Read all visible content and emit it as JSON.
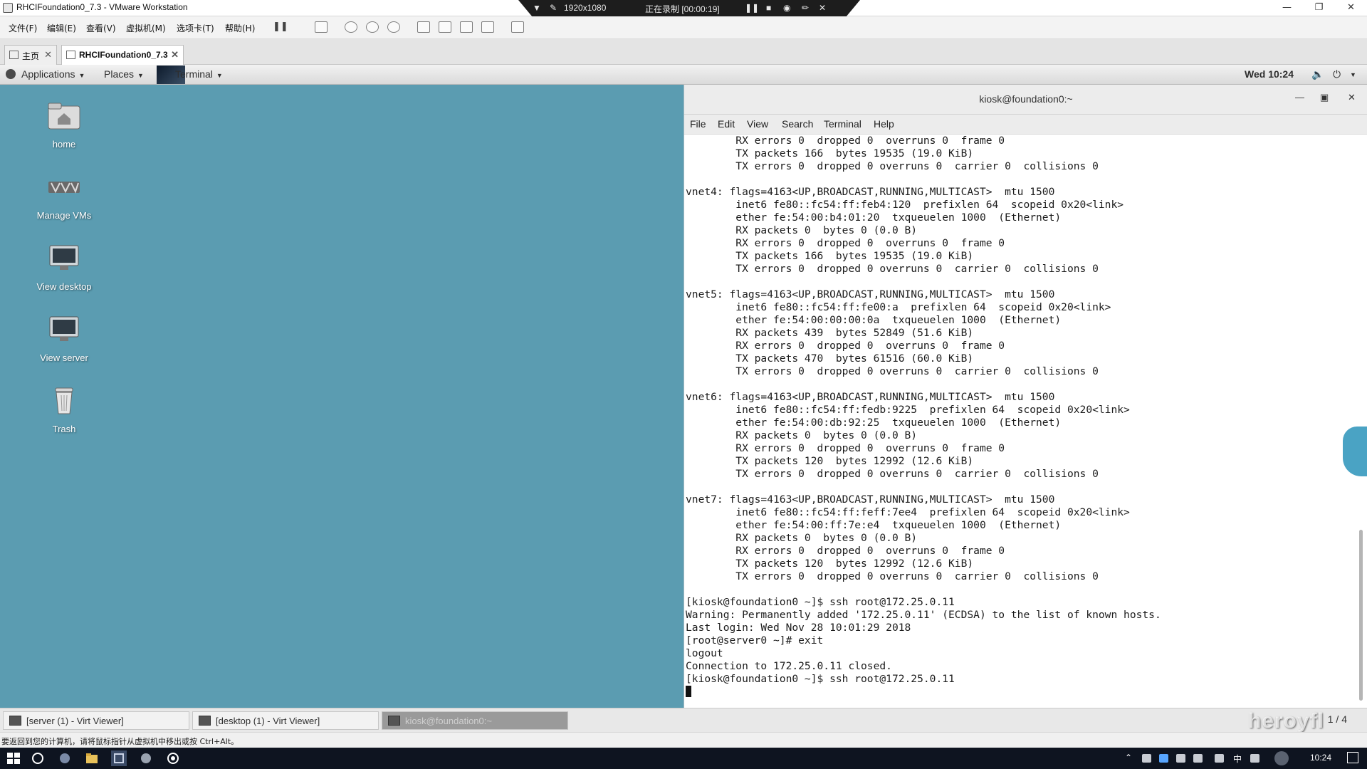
{
  "vmware": {
    "title": "RHCIFoundation0_7.3 - VMware Workstation",
    "recording": {
      "resolution": "1920x1080",
      "status": "正在录制 [00:00:19]"
    },
    "menu": [
      "文件(F)",
      "编辑(E)",
      "查看(V)",
      "虚拟机(M)",
      "选项卡(T)",
      "帮助(H)"
    ],
    "tabs": [
      {
        "label": "主页",
        "active": false
      },
      {
        "label": "RHCIFoundation0_7.3",
        "active": true
      }
    ],
    "status_text": "要返回到您的计算机，请将鼠标指针从虚拟机中移出或按 Ctrl+Alt。"
  },
  "gnome": {
    "topbar": {
      "applications": "Applications",
      "places": "Places",
      "terminal": "Terminal",
      "clock": "Wed 10:24"
    },
    "desktop_icons": [
      {
        "label": "home",
        "icon": "home-folder-icon"
      },
      {
        "label": "Manage VMs",
        "icon": "virt-manager-icon"
      },
      {
        "label": "View desktop",
        "icon": "monitor-icon"
      },
      {
        "label": "View server",
        "icon": "monitor-icon"
      },
      {
        "label": "Trash",
        "icon": "trash-icon"
      }
    ],
    "window_list": [
      {
        "label": "[server (1) - Virt Viewer]",
        "active": false
      },
      {
        "label": "[desktop (1) - Virt Viewer]",
        "active": false
      },
      {
        "label": "kiosk@foundation0:~",
        "active": true
      }
    ],
    "workspace": "1 / 4",
    "watermark": "heroyfl"
  },
  "terminal": {
    "title": "kiosk@foundation0:~",
    "menu": [
      "File",
      "Edit",
      "View",
      "Search",
      "Terminal",
      "Help"
    ],
    "lines": [
      "        RX errors 0  dropped 0  overruns 0  frame 0",
      "        TX packets 166  bytes 19535 (19.0 KiB)",
      "        TX errors 0  dropped 0 overruns 0  carrier 0  collisions 0",
      "",
      "vnet4: flags=4163<UP,BROADCAST,RUNNING,MULTICAST>  mtu 1500",
      "        inet6 fe80::fc54:ff:feb4:120  prefixlen 64  scopeid 0x20<link>",
      "        ether fe:54:00:b4:01:20  txqueuelen 1000  (Ethernet)",
      "        RX packets 0  bytes 0 (0.0 B)",
      "        RX errors 0  dropped 0  overruns 0  frame 0",
      "        TX packets 166  bytes 19535 (19.0 KiB)",
      "        TX errors 0  dropped 0 overruns 0  carrier 0  collisions 0",
      "",
      "vnet5: flags=4163<UP,BROADCAST,RUNNING,MULTICAST>  mtu 1500",
      "        inet6 fe80::fc54:ff:fe00:a  prefixlen 64  scopeid 0x20<link>",
      "        ether fe:54:00:00:00:0a  txqueuelen 1000  (Ethernet)",
      "        RX packets 439  bytes 52849 (51.6 KiB)",
      "        RX errors 0  dropped 0  overruns 0  frame 0",
      "        TX packets 470  bytes 61516 (60.0 KiB)",
      "        TX errors 0  dropped 0 overruns 0  carrier 0  collisions 0",
      "",
      "vnet6: flags=4163<UP,BROADCAST,RUNNING,MULTICAST>  mtu 1500",
      "        inet6 fe80::fc54:ff:fedb:9225  prefixlen 64  scopeid 0x20<link>",
      "        ether fe:54:00:db:92:25  txqueuelen 1000  (Ethernet)",
      "        RX packets 0  bytes 0 (0.0 B)",
      "        RX errors 0  dropped 0  overruns 0  frame 0",
      "        TX packets 120  bytes 12992 (12.6 KiB)",
      "        TX errors 0  dropped 0 overruns 0  carrier 0  collisions 0",
      "",
      "vnet7: flags=4163<UP,BROADCAST,RUNNING,MULTICAST>  mtu 1500",
      "        inet6 fe80::fc54:ff:feff:7ee4  prefixlen 64  scopeid 0x20<link>",
      "        ether fe:54:00:ff:7e:e4  txqueuelen 1000  (Ethernet)",
      "        RX packets 0  bytes 0 (0.0 B)",
      "        RX errors 0  dropped 0  overruns 0  frame 0",
      "        TX packets 120  bytes 12992 (12.6 KiB)",
      "        TX errors 0  dropped 0 overruns 0  carrier 0  collisions 0",
      "",
      "[kiosk@foundation0 ~]$ ssh root@172.25.0.11",
      "Warning: Permanently added '172.25.0.11' (ECDSA) to the list of known hosts.",
      "Last login: Wed Nov 28 10:01:29 2018",
      "[root@server0 ~]# exit",
      "logout",
      "Connection to 172.25.0.11 closed.",
      "[kiosk@foundation0 ~]$ ssh root@172.25.0.11"
    ]
  },
  "windows": {
    "clock": "10:24",
    "ime": "中"
  },
  "colors": {
    "desktop_bg": "#5b9cb1",
    "taskbar_bg": "#0e1420"
  }
}
